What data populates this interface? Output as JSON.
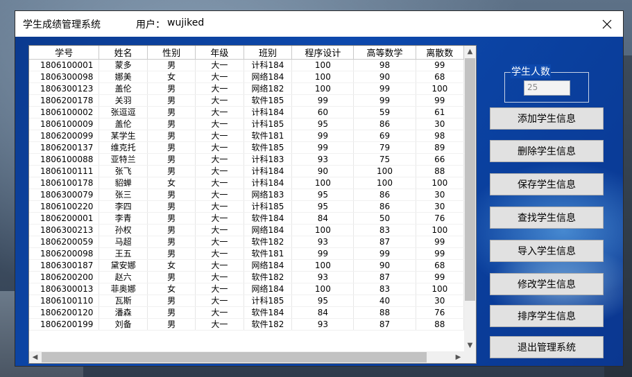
{
  "window": {
    "title": "学生成绩管理系统",
    "user_label": "用户：",
    "user_name": "wujiked"
  },
  "grid": {
    "columns": [
      "学号",
      "姓名",
      "性别",
      "年级",
      "班别",
      "程序设计",
      "高等数学",
      "离散数"
    ],
    "rows": [
      [
        "1806100001",
        "蒙多",
        "男",
        "大一",
        "计科184",
        "100",
        "98",
        "99"
      ],
      [
        "1806300098",
        "娜美",
        "女",
        "大一",
        "网络184",
        "100",
        "90",
        "68"
      ],
      [
        "1806300123",
        "盖伦",
        "男",
        "大一",
        "网络182",
        "100",
        "99",
        "100"
      ],
      [
        "1806200178",
        "关羽",
        "男",
        "大一",
        "软件185",
        "99",
        "99",
        "99"
      ],
      [
        "1806100002",
        "张逗逗",
        "男",
        "大一",
        "计科184",
        "60",
        "59",
        "61"
      ],
      [
        "1806100009",
        "盖伦",
        "男",
        "大一",
        "计科185",
        "95",
        "86",
        "30"
      ],
      [
        "1806200099",
        "某学生",
        "男",
        "大一",
        "软件181",
        "99",
        "69",
        "98"
      ],
      [
        "1806200137",
        "维克托",
        "男",
        "大一",
        "软件185",
        "99",
        "79",
        "89"
      ],
      [
        "1806100088",
        "亚特兰",
        "男",
        "大一",
        "计科183",
        "93",
        "75",
        "66"
      ],
      [
        "1806100111",
        "张飞",
        "男",
        "大一",
        "计科184",
        "90",
        "100",
        "88"
      ],
      [
        "1806100178",
        "貂蝉",
        "女",
        "大一",
        "计科184",
        "100",
        "100",
        "100"
      ],
      [
        "1806300079",
        "张三",
        "男",
        "大一",
        "网络183",
        "95",
        "86",
        "30"
      ],
      [
        "1806100220",
        "李四",
        "男",
        "大一",
        "计科185",
        "95",
        "86",
        "30"
      ],
      [
        "1806200001",
        "李青",
        "男",
        "大一",
        "软件184",
        "84",
        "50",
        "76"
      ],
      [
        "1806300213",
        "孙权",
        "男",
        "大一",
        "网络184",
        "100",
        "83",
        "100"
      ],
      [
        "1806200059",
        "马超",
        "男",
        "大一",
        "软件182",
        "93",
        "87",
        "99"
      ],
      [
        "1806200098",
        "王五",
        "男",
        "大一",
        "软件181",
        "99",
        "99",
        "99"
      ],
      [
        "1806300187",
        "黛安娜",
        "女",
        "大一",
        "网络184",
        "100",
        "90",
        "68"
      ],
      [
        "1806200200",
        "赵六",
        "男",
        "大一",
        "软件182",
        "93",
        "87",
        "99"
      ],
      [
        "1806300013",
        "菲奥娜",
        "女",
        "大一",
        "网络184",
        "100",
        "83",
        "100"
      ],
      [
        "1806100110",
        "瓦斯",
        "男",
        "大一",
        "计科185",
        "95",
        "40",
        "30"
      ],
      [
        "1806200120",
        "潘森",
        "男",
        "大一",
        "软件184",
        "84",
        "88",
        "76"
      ],
      [
        "1806200199",
        "刘备",
        "男",
        "大一",
        "软件182",
        "93",
        "87",
        "88"
      ]
    ]
  },
  "student_count": {
    "label": "学生人数",
    "value": "25"
  },
  "buttons": {
    "add": "添加学生信息",
    "delete": "删除学生信息",
    "save": "保存学生信息",
    "find": "查找学生信息",
    "import": "导入学生信息",
    "modify": "修改学生信息",
    "sort": "排序学生信息",
    "exit": "退出管理系统"
  }
}
